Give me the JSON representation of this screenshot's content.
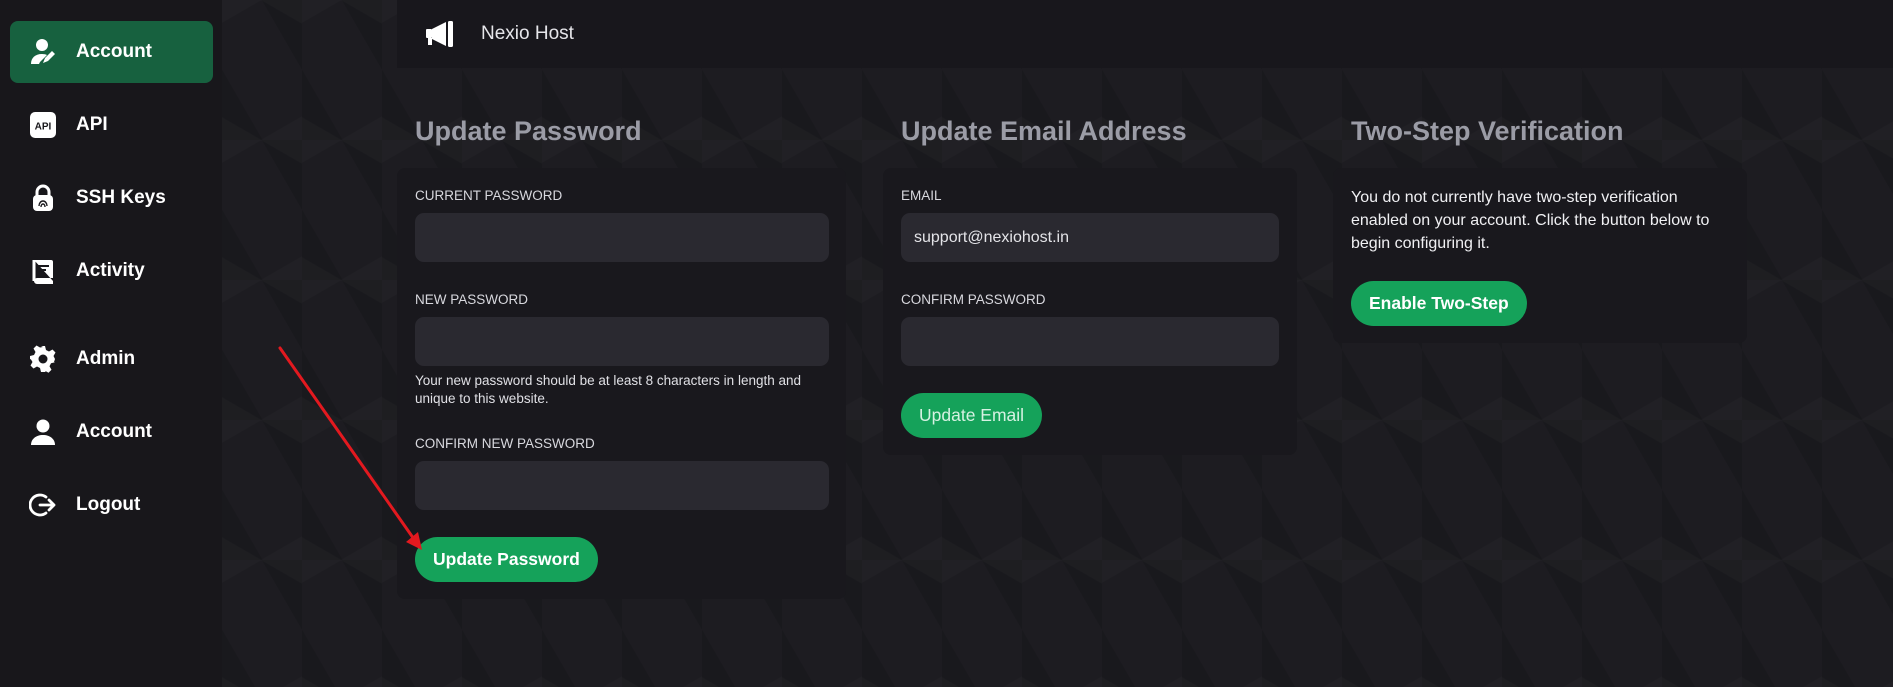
{
  "sidebar": {
    "items": [
      {
        "label": "Account",
        "icon": "user-edit-icon",
        "active": true
      },
      {
        "label": "API",
        "icon": "api-icon"
      },
      {
        "label": "SSH Keys",
        "icon": "lock-fingerprint-icon"
      },
      {
        "label": "Activity",
        "icon": "book-icon"
      },
      {
        "label": "Admin",
        "icon": "gear-icon"
      },
      {
        "label": "Account",
        "icon": "user-icon"
      },
      {
        "label": "Logout",
        "icon": "logout-icon"
      }
    ]
  },
  "header": {
    "brand_icon": "megaphone-icon",
    "brand_name": "Nexio Host"
  },
  "password_section": {
    "title": "Update Password",
    "current_label": "CURRENT PASSWORD",
    "current_value": "",
    "new_label": "NEW PASSWORD",
    "new_value": "",
    "helper": "Your new password should be at least 8 characters in length and unique to this website.",
    "confirm_label": "CONFIRM NEW PASSWORD",
    "confirm_value": "",
    "button": "Update Password"
  },
  "email_section": {
    "title": "Update Email Address",
    "email_label": "EMAIL",
    "email_value": "support@nexiohost.in",
    "confirm_label": "CONFIRM PASSWORD",
    "confirm_value": "",
    "button": "Update Email"
  },
  "twostep_section": {
    "title": "Two-Step Verification",
    "text": "You do not currently have two-step verification enabled on your account. Click the button below to begin configuring it.",
    "button": "Enable Two-Step"
  },
  "colors": {
    "accent": "#15a25a",
    "active_nav": "#17613f",
    "annotation_arrow": "#e3191f"
  }
}
